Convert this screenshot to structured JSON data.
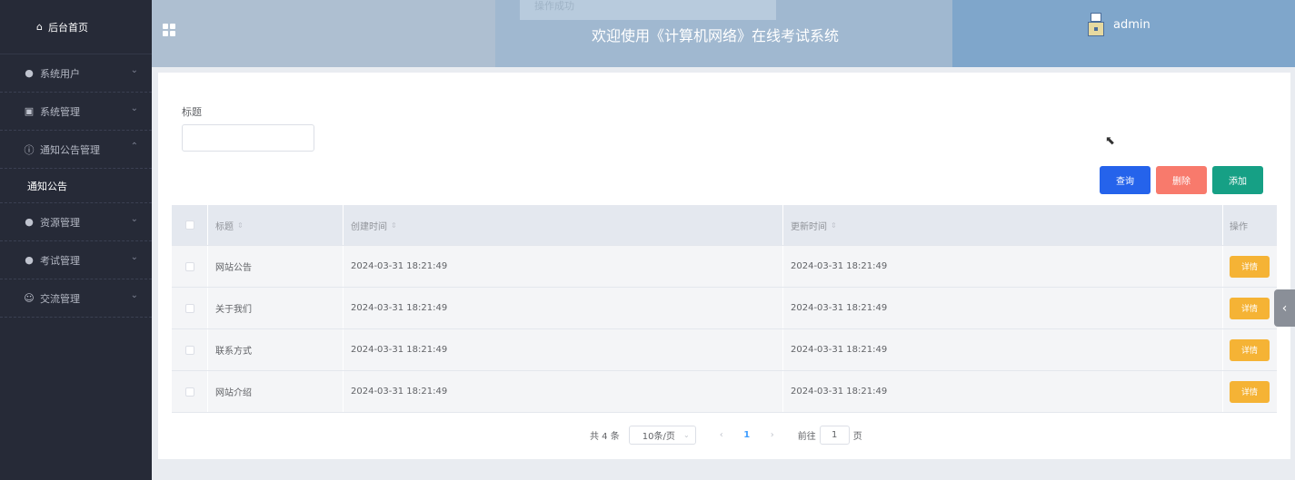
{
  "sidebar": {
    "home": {
      "label": "后台首页",
      "icon": "home-icon"
    },
    "items": [
      {
        "label": "系统用户",
        "icon": "user-icon"
      },
      {
        "label": "系统管理",
        "icon": "picture-icon"
      },
      {
        "label": "通知公告管理",
        "icon": "info-icon",
        "expanded": true,
        "sub": [
          "通知公告"
        ]
      },
      {
        "label": "资源管理",
        "icon": "location-icon"
      },
      {
        "label": "考试管理",
        "icon": "location-icon"
      },
      {
        "label": "交流管理",
        "icon": "chat-icon"
      }
    ]
  },
  "header": {
    "toast": "操作成功",
    "title": "欢迎使用《计算机网络》在线考试系统",
    "user": "admin"
  },
  "search": {
    "label": "标题",
    "value": ""
  },
  "toolbar": {
    "query": "查询",
    "delete": "删除",
    "add": "添加"
  },
  "table": {
    "headers": [
      "标题",
      "创建时间",
      "更新时间",
      "操作"
    ],
    "rows": [
      {
        "title": "网站公告",
        "created": "2024-03-31 18:21:49",
        "updated": "2024-03-31 18:21:49",
        "action": "详情"
      },
      {
        "title": "关于我们",
        "created": "2024-03-31 18:21:49",
        "updated": "2024-03-31 18:21:49",
        "action": "详情"
      },
      {
        "title": "联系方式",
        "created": "2024-03-31 18:21:49",
        "updated": "2024-03-31 18:21:49",
        "action": "详情"
      },
      {
        "title": "网站介绍",
        "created": "2024-03-31 18:21:49",
        "updated": "2024-03-31 18:21:49",
        "action": "详情"
      }
    ]
  },
  "pager": {
    "total": "共 4 条",
    "size": "10条/页",
    "current": "1",
    "goto_label": "前往",
    "goto_value": "1",
    "page_suffix": "页"
  },
  "colors": {
    "sidebar": "#262a37",
    "query": "#2563eb",
    "delete": "#f87a6c",
    "add": "#16a085",
    "detail": "#f5b335"
  }
}
